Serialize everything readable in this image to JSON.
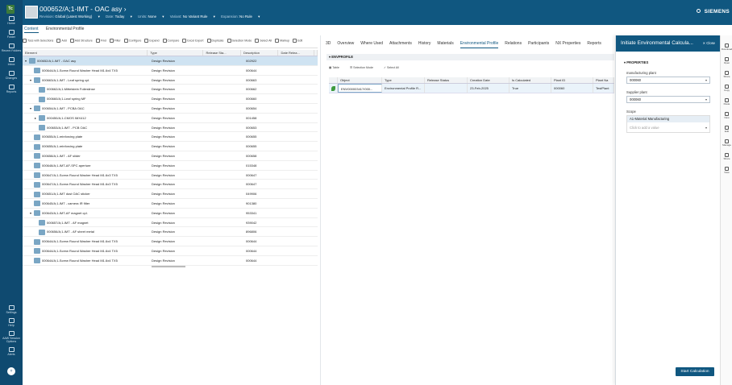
{
  "app": {
    "logo_text": "Tc",
    "title": "000652/A;1-IMT - OAC asy",
    "brand": "SIEMENS"
  },
  "header": {
    "revision_label": "Revision:",
    "revision_value": "Global (Latest Working)",
    "date_label": "Date:",
    "date_value": "Today",
    "units_label": "Units:",
    "units_value": "None",
    "variant_label": "Variant:",
    "variant_value": "No Variant Rule",
    "expansion_label": "Expansion:",
    "expansion_value": "No Rule"
  },
  "leftnav": {
    "top": [
      "Home",
      "Folder",
      "Recent Folders",
      "Inbox",
      "Changes",
      "Reports"
    ],
    "bottom": [
      "Settings",
      "Help",
      "AAW Session Options",
      "Alerts"
    ],
    "avatar": "T"
  },
  "content_tabs": [
    "Content",
    "Environmental Profile"
  ],
  "toolbar": [
    "Toss with Selections",
    "Add",
    "Add Structure",
    "Find",
    "Filter",
    "Configure",
    "Expand",
    "Compare",
    "Excel Export",
    "Duplicate",
    "Selection Mode",
    "Select All",
    "Markup",
    "Edit"
  ],
  "tree": {
    "columns": [
      "Element",
      "Type",
      "Release Sta...",
      "Description",
      "Date Relea...",
      "Release Effectivity"
    ],
    "rows": [
      {
        "indent": 0,
        "exp": "▾",
        "name": "000652/A;1-IMT - OAC asy",
        "type": "Design Revision",
        "desc": "002922",
        "sel": true
      },
      {
        "indent": 1,
        "exp": "",
        "name": "000644/A;1-Screw Round Washer Head M1.6x4 TX5",
        "type": "Design Revision",
        "desc": "000644"
      },
      {
        "indent": 1,
        "exp": "▾",
        "name": "000663/A;1-IMT - Leaf spring cpl.",
        "type": "Design Revision",
        "desc": "000663"
      },
      {
        "indent": 2,
        "exp": "",
        "name": "000662/A;1-Mittelstein Folieslinse",
        "type": "Design Revision",
        "desc": "000662"
      },
      {
        "indent": 2,
        "exp": "",
        "name": "000660/A;1-Leaf spring MF",
        "type": "Design Revision",
        "desc": "000660"
      },
      {
        "indent": 1,
        "exp": "▾",
        "name": "000654/A;1-IMT - PCBA OAC",
        "type": "Design Revision",
        "desc": "000654"
      },
      {
        "indent": 2,
        "exp": "▸",
        "name": "000450/A;1-CMOS IMX412",
        "type": "Design Revision",
        "desc": "001458"
      },
      {
        "indent": 2,
        "exp": "",
        "name": "000653/A;1-IMT - PCB OAC",
        "type": "Design Revision",
        "desc": "000653"
      },
      {
        "indent": 1,
        "exp": "",
        "name": "000655/A;1-reinforcing plate",
        "type": "Design Revision",
        "desc": "000655"
      },
      {
        "indent": 1,
        "exp": "",
        "name": "000655/A;1-reinforcing plate",
        "type": "Design Revision",
        "desc": "000655"
      },
      {
        "indent": 1,
        "exp": "",
        "name": "000658/A;1-IMT - AF slider",
        "type": "Design Revision",
        "desc": "000658"
      },
      {
        "indent": 1,
        "exp": "",
        "name": "000648/A;1-IMT-AF-SPC aperture",
        "type": "Design Revision",
        "desc": "015348"
      },
      {
        "indent": 1,
        "exp": "",
        "name": "000647/A;1-Screw Round Washer Head M1.6x3 TX5",
        "type": "Design Revision",
        "desc": "000647"
      },
      {
        "indent": 1,
        "exp": "",
        "name": "000647/A;1-Screw Round Washer Head M1.6x3 TX5",
        "type": "Design Revision",
        "desc": "000647"
      },
      {
        "indent": 1,
        "exp": "",
        "name": "000651/A;1-IMT dust OAC sticker",
        "type": "Design Revision",
        "desc": "049906"
      },
      {
        "indent": 1,
        "exp": "",
        "name": "000645/A;1-IMT - camera IR filter",
        "type": "Design Revision",
        "desc": "901380"
      },
      {
        "indent": 1,
        "exp": "▾",
        "name": "000643/A;1-IMT-AF magnet cpl.",
        "type": "Design Revision",
        "desc": "953341"
      },
      {
        "indent": 2,
        "exp": "",
        "name": "000657/A;1-IMT - AF magnet",
        "type": "Design Revision",
        "desc": "939042"
      },
      {
        "indent": 2,
        "exp": "",
        "name": "000656/A;1-IMT - AF sheet metal",
        "type": "Design Revision",
        "desc": "896806"
      },
      {
        "indent": 1,
        "exp": "",
        "name": "000644/A;1-Screw Round Washer Head M1.6x4 TX5",
        "type": "Design Revision",
        "desc": "000644"
      },
      {
        "indent": 1,
        "exp": "",
        "name": "000644/A;1-Screw Round Washer Head M1.6x4 TX5",
        "type": "Design Revision",
        "desc": "000644"
      },
      {
        "indent": 1,
        "exp": "",
        "name": "000644/A;1-Screw Round Washer Head M1.6x4 TX5",
        "type": "Design Revision",
        "desc": "000644"
      }
    ]
  },
  "right_tabs": [
    "3D",
    "Overview",
    "Where Used",
    "Attachments",
    "History",
    "Materials",
    "Environmental Profile",
    "Relations",
    "Participants",
    "NX Properties",
    "Reports"
  ],
  "env": {
    "section": "ENVPROFILE",
    "toolbar": [
      "Table",
      "Selection Mode",
      "Select All"
    ],
    "columns": [
      "Object",
      "Type",
      "Release Status",
      "Creation Date",
      "Is Calculated",
      "Plant ID",
      "Plant Na"
    ],
    "row": {
      "object": "ENV000003417/000...",
      "type": "Environmental Profile R...",
      "status": "",
      "date": "23-Feb-2025",
      "calc": "True",
      "plant_id": "000060",
      "plant_name": "TestPlant"
    }
  },
  "panel": {
    "title": "Initiate Environmental Calcula...",
    "close": "Close",
    "section": "PROPERTIES",
    "mfg_label": "manufacturing plant",
    "mfg_value": "000060",
    "supplier_label": "Supplier plant",
    "supplier_value": "000060",
    "scope_label": "Scope",
    "scope_chip": "A1-Material Manufacturing",
    "scope_placeholder": "Click to add a value",
    "button": "Start Calculation"
  },
  "rightrail": [
    "Download",
    "Open",
    "Share",
    "Copy",
    "Paste",
    "New",
    "Edit",
    "Manage",
    "Share",
    "View"
  ]
}
